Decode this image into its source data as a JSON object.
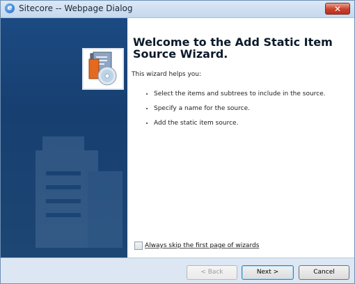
{
  "window": {
    "title": "Sitecore -- Webpage Dialog",
    "close_label": "✕"
  },
  "wizard": {
    "heading": "Welcome to the Add Static Item Source Wizard.",
    "intro": "This wizard helps you:",
    "bullets": [
      "Select the items and subtrees to include in the source.",
      "Specify a name for the source.",
      "Add the static item source."
    ],
    "skip_label": "Always skip the first page of wizards",
    "skip_checked": false
  },
  "buttons": {
    "back": "< Back",
    "next": "Next >",
    "cancel": "Cancel"
  },
  "icons": {
    "title_icon": "ie-icon",
    "wizard_icon": "document-disc-icon"
  },
  "colors": {
    "sidebar": "#1b4a82",
    "footer": "#dde7f3",
    "close_button": "#c9402b"
  }
}
